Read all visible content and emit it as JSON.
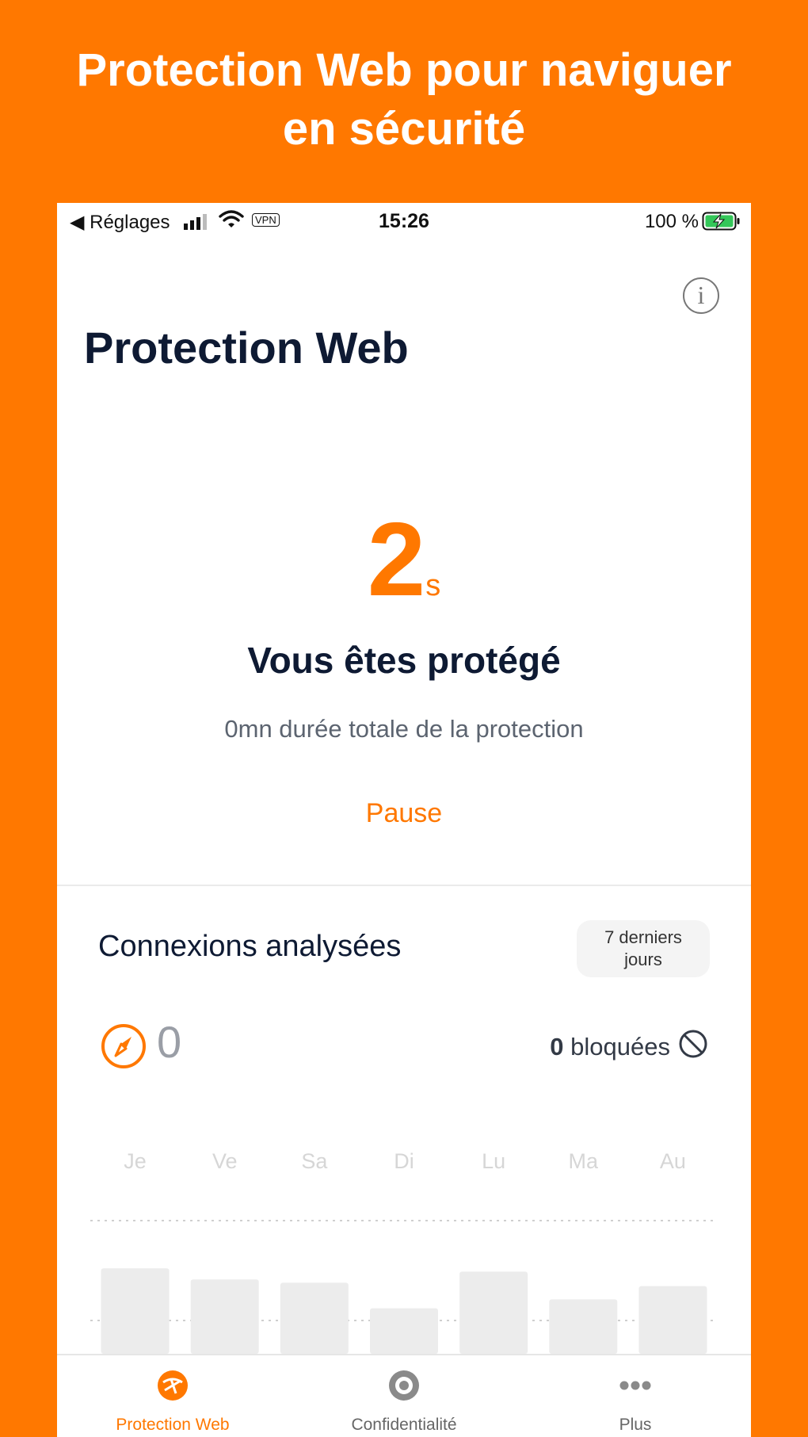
{
  "banner": {
    "line1": "Protection Web pour naviguer",
    "line2": "en sécurité"
  },
  "status_bar": {
    "back_label": "◀ Réglages",
    "vpn": "VPN",
    "time": "15:26",
    "battery": "100 %"
  },
  "header": {
    "title": "Protection Web",
    "info_glyph": "i"
  },
  "protection": {
    "timer_value": "2",
    "timer_unit": "s",
    "status": "Vous êtes protégé",
    "total_duration": "0mn durée totale de la protection",
    "pause_label": "Pause"
  },
  "connections": {
    "title": "Connexions analysées",
    "period_line1": "7 derniers",
    "period_line2": "jours",
    "scanned_count": "0",
    "blocked_count": "0",
    "blocked_label": "bloquées"
  },
  "chart_data": {
    "type": "bar",
    "categories": [
      "Je",
      "Ve",
      "Sa",
      "Di",
      "Lu",
      "Ma",
      "Au"
    ],
    "values": [
      0,
      0,
      0,
      0,
      0,
      0,
      0
    ],
    "placeholder_levels": [
      0.77,
      0.67,
      0.64,
      0.41,
      0.74,
      0.49,
      0.61
    ],
    "colors": {
      "bar": "#ececec",
      "label": "#d6d6d6",
      "grid": "#cfcfcf"
    }
  },
  "tabs": [
    {
      "label": "Protection Web",
      "icon": "shield-web-icon",
      "active": true
    },
    {
      "label": "Confidentialité",
      "icon": "eye-icon",
      "active": false
    },
    {
      "label": "Plus",
      "icon": "more-dots-icon",
      "active": false
    }
  ],
  "colors": {
    "brand": "#FF7800",
    "title": "#0e1a33",
    "muted": "#5c6470"
  }
}
